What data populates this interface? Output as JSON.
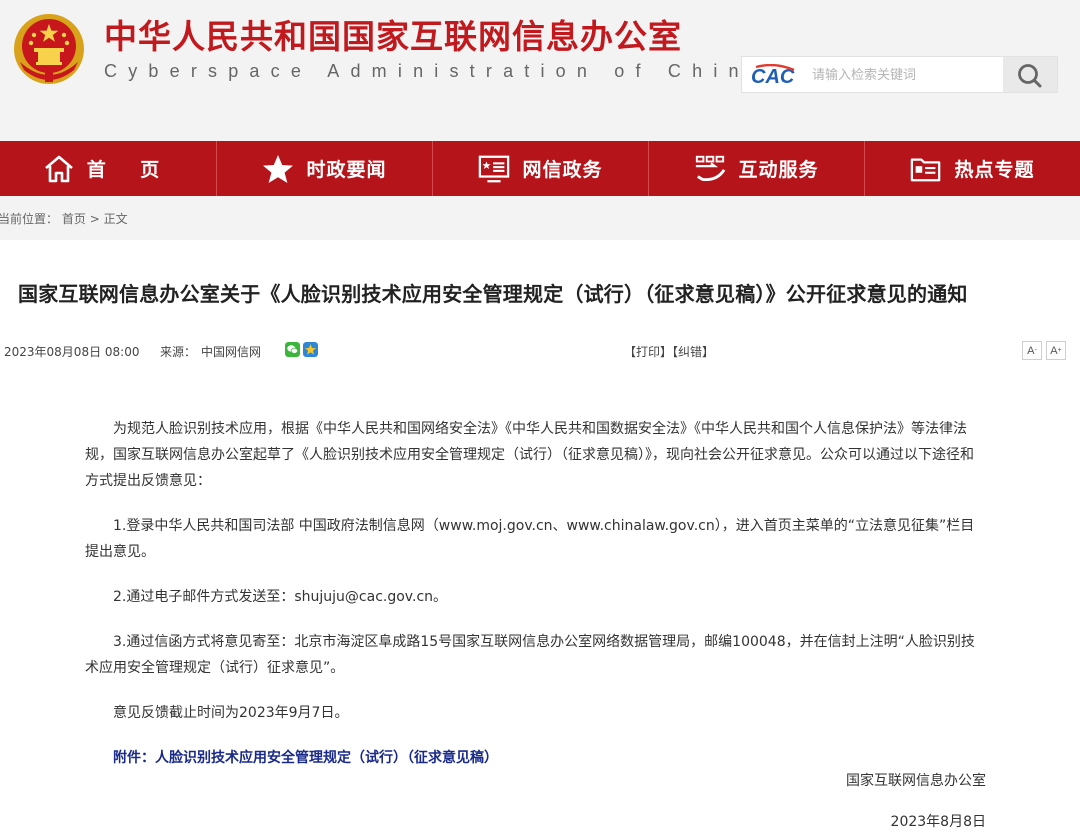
{
  "header": {
    "title": "中华人民共和国国家互联网信息办公室",
    "subtitle": "Cyberspace Administration of China",
    "cac_logo_text": "CAC",
    "search": {
      "placeholder": "请输入检索关键词",
      "value": ""
    }
  },
  "nav": {
    "items": [
      {
        "label": "首 页",
        "icon": "home-icon"
      },
      {
        "label": "时政要闻",
        "icon": "star-icon"
      },
      {
        "label": "网信政务",
        "icon": "screen-icon"
      },
      {
        "label": "互动服务",
        "icon": "interaction-icon"
      },
      {
        "label": "热点专题",
        "icon": "folder-icon"
      }
    ]
  },
  "breadcrumb": {
    "label": "当前位置：",
    "home": "首页",
    "separator": ">",
    "current": "正文"
  },
  "article": {
    "title": "国家互联网信息办公室关于《人脸识别技术应用安全管理规定（试行）（征求意见稿）》公开征求意见的通知",
    "date": "2023年08月08日 08:00",
    "source_label": "来源：",
    "source": "中国网信网",
    "print_label": "【打印】",
    "correct_label": "【纠错】",
    "font_decrease": "A",
    "font_increase": "A",
    "paragraphs": [
      "为规范人脸识别技术应用，根据《中华人民共和国网络安全法》《中华人民共和国数据安全法》《中华人民共和国个人信息保护法》等法律法规，国家互联网信息办公室起草了《人脸识别技术应用安全管理规定（试行）（征求意见稿）》，现向社会公开征求意见。公众可以通过以下途径和方式提出反馈意见：",
      "1.登录中华人民共和国司法部 中国政府法制信息网（www.moj.gov.cn、www.chinalaw.gov.cn），进入首页主菜单的“立法意见征集”栏目提出意见。",
      "2.通过电子邮件方式发送至：shujuju@cac.gov.cn。",
      "3.通过信函方式将意见寄至：北京市海淀区阜成路15号国家互联网信息办公室网络数据管理局，邮编100048，并在信封上注明“人脸识别技术应用安全管理规定（试行）征求意见”。",
      "意见反馈截止时间为2023年9月7日。"
    ],
    "attachment": "附件：人脸识别技术应用安全管理规定（试行）（征求意见稿）",
    "signature": "国家互联网信息办公室",
    "sign_date": "2023年8月8日"
  },
  "colors": {
    "brand_red": "#c1191e",
    "nav_red": "#b5141b",
    "attachment_blue": "#1a2a8a"
  }
}
